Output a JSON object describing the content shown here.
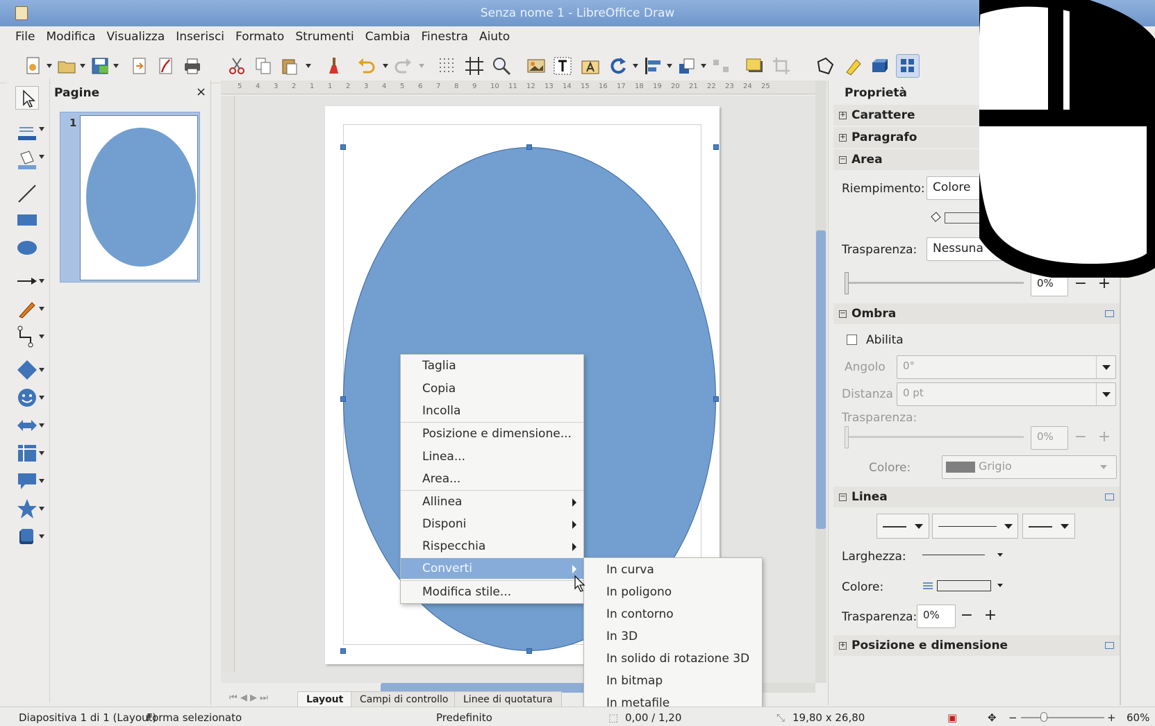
{
  "window": {
    "title": "Senza nome 1 - LibreOffice Draw"
  },
  "menubar": [
    "File",
    "Modifica",
    "Visualizza",
    "Inserisci",
    "Formato",
    "Strumenti",
    "Cambia",
    "Finestra",
    "Aiuto"
  ],
  "pages_panel": {
    "title": "Pagine",
    "close_label": "×",
    "slide_number": "1"
  },
  "ruler": {
    "h_ticks": [
      "5",
      "4",
      "3",
      "2",
      "1",
      "1",
      "2",
      "3",
      "4",
      "5",
      "6",
      "7",
      "8",
      "9",
      "10",
      "11",
      "12",
      "13",
      "14",
      "15",
      "16",
      "17",
      "18",
      "19",
      "20",
      "21",
      "22",
      "23",
      "24",
      "25"
    ]
  },
  "layout_tabs": [
    "Layout",
    "Campi di controllo",
    "Linee di quotatura"
  ],
  "context_menu": {
    "items": [
      {
        "label": "Taglia"
      },
      {
        "label": "Copia"
      },
      {
        "label": "Incolla"
      },
      {
        "label": "Posizione e dimensione..."
      },
      {
        "label": "Linea..."
      },
      {
        "label": "Area..."
      },
      {
        "label": "Allinea"
      },
      {
        "label": "Disponi"
      },
      {
        "label": "Rispecchia"
      },
      {
        "label": "Converti"
      },
      {
        "label": "Modifica stile..."
      }
    ],
    "submenu_items": [
      "In curva",
      "In poligono",
      "In contorno",
      "In 3D",
      "In solido di rotazione 3D",
      "In bitmap",
      "In metafile"
    ]
  },
  "properties": {
    "title": "Proprietà",
    "sections": {
      "carattere": "Carattere",
      "paragrafo": "Paragrafo",
      "area": "Area",
      "ombra": "Ombra",
      "linea": "Linea",
      "posizione": "Posizione e dimensione"
    },
    "area": {
      "fill_label": "Riempimento:",
      "fill_value": "Colore",
      "transparency_label": "Trasparenza:",
      "transparency_value": "Nessuna",
      "transparency_percent": "0%",
      "fill_color": "#729fcf"
    },
    "ombra": {
      "enable_label": "Abilita",
      "angle_label": "Angolo",
      "angle_value": "0°",
      "distance_label": "Distanza",
      "distance_value": "0 pt",
      "transparency_label": "Trasparenza:",
      "transparency_percent": "0%",
      "color_label": "Colore:",
      "color_value": "Grigio"
    },
    "linea": {
      "width_label": "Larghezza:",
      "color_label": "Colore:",
      "transparency_label": "Trasparenza:",
      "transparency_value": "0%",
      "line_color": "#3465a4"
    },
    "minus": "−",
    "plus": "+"
  },
  "statusbar": {
    "slide_info": "Diapositiva 1 di 1 (Layout)",
    "selection": "Forma selezionato",
    "style": "Predefinito",
    "position": "0,00 / 1,20",
    "size": "19,80 x 26,80",
    "zoom_minus": "−",
    "zoom_plus": "+",
    "zoom": "60%"
  },
  "colors": {
    "accent": "#87acda",
    "shape_fill": "#729fcf",
    "shape_border": "#3465a4"
  }
}
